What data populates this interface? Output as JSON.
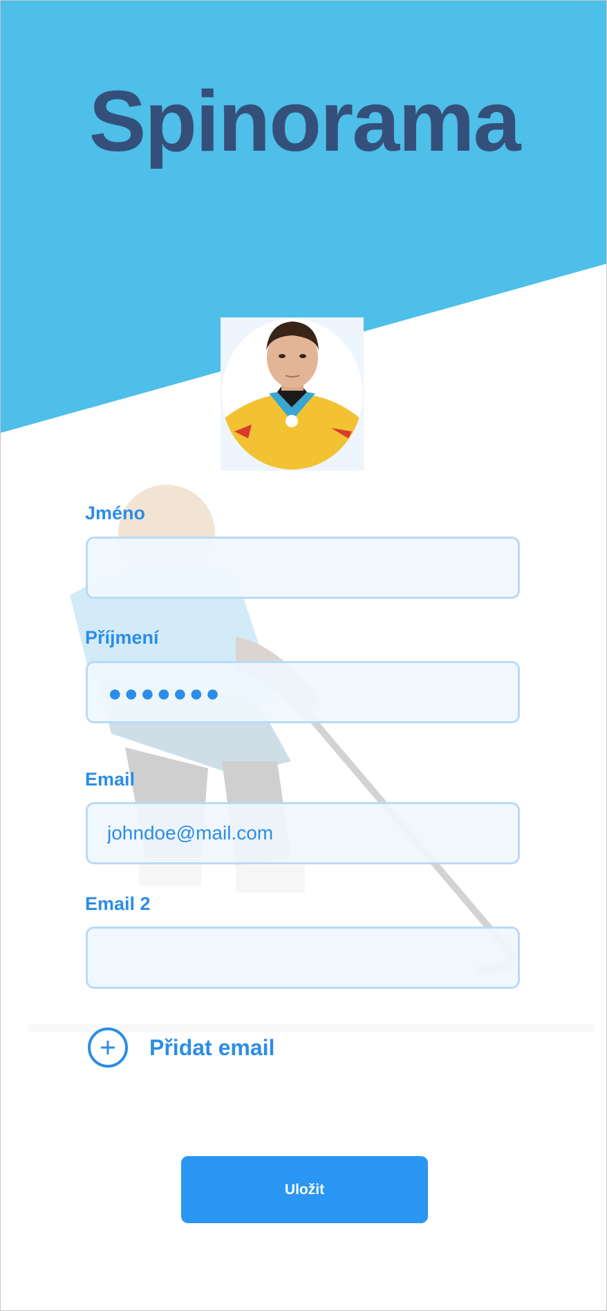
{
  "app": {
    "title": "Spinorama",
    "brand_color": "#4dbfe9",
    "title_color": "#34507a",
    "accent_color": "#2b8de8"
  },
  "profile": {
    "avatar_icon": "player-photo"
  },
  "form": {
    "first_name": {
      "label": "Jméno",
      "value": ""
    },
    "last_name": {
      "label": "Příjmení",
      "value": "●●●●●●●"
    },
    "email": {
      "label": "Email",
      "value": "johndoe@mail.com"
    },
    "email2": {
      "label": "Email 2",
      "value": ""
    },
    "add_email": {
      "label": "Přidat email",
      "icon": "plus-circle-icon"
    }
  },
  "actions": {
    "save_label": "Uložit"
  }
}
